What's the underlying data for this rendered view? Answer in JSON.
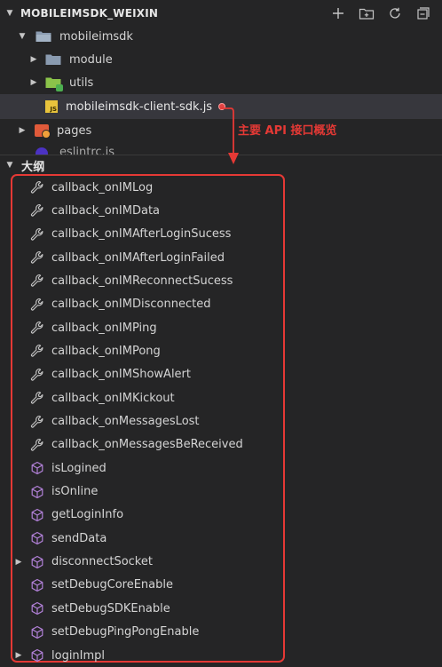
{
  "explorer": {
    "section_title": "MOBILEIMSDK_WEIXIN",
    "actions": [
      {
        "name": "new-file-icon",
        "glyph": "+"
      },
      {
        "name": "new-folder-icon",
        "glyph": "folder-plus"
      },
      {
        "name": "refresh-icon",
        "glyph": "refresh"
      },
      {
        "name": "collapse-all-icon",
        "glyph": "collapse"
      }
    ],
    "tree": {
      "root_folder": "mobileimsdk",
      "module_folder": "module",
      "utils_folder": "utils",
      "selected_file": "mobileimsdk-client-sdk.js",
      "js_badge": "JS",
      "pages_folder": "pages",
      "partial_file": "eslintrc.js"
    }
  },
  "annotation": {
    "text": "主要 API 接口概览",
    "color": "#e53935"
  },
  "outline": {
    "title": "大纲",
    "items": [
      {
        "label": "callback_onIMLog",
        "icon": "wrench-icon"
      },
      {
        "label": "callback_onIMData",
        "icon": "wrench-icon"
      },
      {
        "label": "callback_onIMAfterLoginSucess",
        "icon": "wrench-icon"
      },
      {
        "label": "callback_onIMAfterLoginFailed",
        "icon": "wrench-icon"
      },
      {
        "label": "callback_onIMReconnectSucess",
        "icon": "wrench-icon"
      },
      {
        "label": "callback_onIMDisconnected",
        "icon": "wrench-icon"
      },
      {
        "label": "callback_onIMPing",
        "icon": "wrench-icon"
      },
      {
        "label": "callback_onIMPong",
        "icon": "wrench-icon"
      },
      {
        "label": "callback_onIMShowAlert",
        "icon": "wrench-icon"
      },
      {
        "label": "callback_onIMKickout",
        "icon": "wrench-icon"
      },
      {
        "label": "callback_onMessagesLost",
        "icon": "wrench-icon"
      },
      {
        "label": "callback_onMessagesBeReceived",
        "icon": "wrench-icon"
      },
      {
        "label": "isLogined",
        "icon": "cube-icon"
      },
      {
        "label": "isOnline",
        "icon": "cube-icon"
      },
      {
        "label": "getLoginInfo",
        "icon": "cube-icon"
      },
      {
        "label": "sendData",
        "icon": "cube-icon"
      },
      {
        "label": "disconnectSocket",
        "icon": "cube-icon",
        "expandable": true
      },
      {
        "label": "setDebugCoreEnable",
        "icon": "cube-icon"
      },
      {
        "label": "setDebugSDKEnable",
        "icon": "cube-icon"
      },
      {
        "label": "setDebugPingPongEnable",
        "icon": "cube-icon"
      },
      {
        "label": "loginImpl",
        "icon": "cube-icon",
        "expandable": true
      }
    ]
  },
  "colors": {
    "background": "#252526",
    "selected_row": "#37373d",
    "annotation_red": "#e53935",
    "folder": "#8a9bb0",
    "js_badge": "#e8c33c",
    "method_purple": "#b180d7"
  }
}
